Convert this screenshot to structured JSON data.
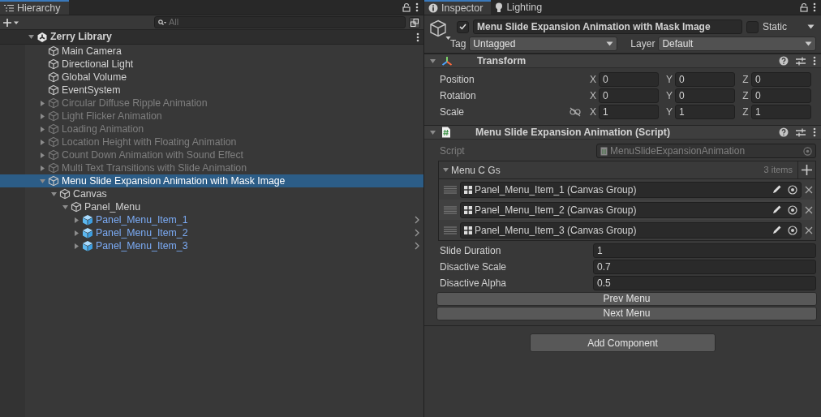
{
  "hierarchy": {
    "title": "Hierarchy",
    "search": {
      "placeholder": "All"
    },
    "tree": [
      {
        "kind": "scene",
        "label": "Zerry Library",
        "expanded": true,
        "selected": false,
        "disabled": false,
        "children": [
          {
            "kind": "object",
            "label": "Main Camera",
            "selected": false,
            "disabled": false
          },
          {
            "kind": "object",
            "label": "Directional Light",
            "selected": false,
            "disabled": false
          },
          {
            "kind": "object",
            "label": "Global Volume",
            "selected": false,
            "disabled": false
          },
          {
            "kind": "object",
            "label": "EventSystem",
            "selected": false,
            "disabled": false
          },
          {
            "kind": "object",
            "label": "Circular Diffuse Ripple Animation",
            "expanded": false,
            "selected": false,
            "disabled": true
          },
          {
            "kind": "object",
            "label": "Light Flicker Animation",
            "expanded": false,
            "selected": false,
            "disabled": true
          },
          {
            "kind": "object",
            "label": "Loading Animation",
            "expanded": false,
            "selected": false,
            "disabled": true
          },
          {
            "kind": "object",
            "label": "Location Height with Floating Animation",
            "expanded": false,
            "selected": false,
            "disabled": true
          },
          {
            "kind": "object",
            "label": "Count Down Animation with Sound Effect",
            "expanded": false,
            "selected": false,
            "disabled": true
          },
          {
            "kind": "object",
            "label": "Multi Text Transitions with Slide Animation",
            "expanded": false,
            "selected": false,
            "disabled": true
          },
          {
            "kind": "object",
            "label": "Menu Slide Expansion Animation with Mask Image",
            "expanded": true,
            "selected": true,
            "disabled": false,
            "children": [
              {
                "kind": "object",
                "label": "Canvas",
                "expanded": true,
                "selected": false,
                "disabled": false,
                "children": [
                  {
                    "kind": "object",
                    "label": "Panel_Menu",
                    "expanded": true,
                    "selected": false,
                    "disabled": false,
                    "children": [
                      {
                        "kind": "prefab",
                        "label": "Panel_Menu_Item_1",
                        "expanded": false,
                        "selected": false,
                        "disabled": false
                      },
                      {
                        "kind": "prefab",
                        "label": "Panel_Menu_Item_2",
                        "expanded": false,
                        "selected": false,
                        "disabled": false
                      },
                      {
                        "kind": "prefab",
                        "label": "Panel_Menu_Item_3",
                        "expanded": false,
                        "selected": false,
                        "disabled": false
                      }
                    ]
                  }
                ]
              }
            ]
          }
        ]
      }
    ]
  },
  "inspector": {
    "tabs": [
      {
        "label": "Inspector",
        "kind": "info",
        "selected": true
      },
      {
        "label": "Lighting",
        "kind": "bulb",
        "selected": false
      }
    ],
    "object": {
      "active": true,
      "name": "Menu Slide Expansion Animation with Mask Image",
      "static_label": "Static",
      "static": false,
      "tag_label": "Tag",
      "tag": "Untagged",
      "layer_label": "Layer",
      "layer": "Default"
    },
    "components": [
      {
        "kind": "transform",
        "title": "Transform",
        "expanded": true,
        "rows": [
          {
            "label": "Position",
            "axes": [
              "X",
              "Y",
              "Z"
            ],
            "values": [
              "0",
              "0",
              "0"
            ]
          },
          {
            "label": "Rotation",
            "axes": [
              "X",
              "Y",
              "Z"
            ],
            "values": [
              "0",
              "0",
              "0"
            ]
          },
          {
            "label": "Scale",
            "constrained": false,
            "axes": [
              "X",
              "Y",
              "Z"
            ],
            "values": [
              "1",
              "1",
              "1"
            ]
          }
        ]
      },
      {
        "kind": "script",
        "title": "Menu Slide Expansion Animation (Script)",
        "expanded": true,
        "script_label": "Script",
        "script": "MenuSlideExpansionAnimation",
        "list": {
          "label": "Menu C Gs",
          "expanded": true,
          "count": "3 items",
          "items": [
            "Panel_Menu_Item_1 (Canvas Group)",
            "Panel_Menu_Item_2 (Canvas Group)",
            "Panel_Menu_Item_3 (Canvas Group)"
          ]
        },
        "fields": [
          {
            "label": "Slide Duration",
            "value": "1"
          },
          {
            "label": "Disactive Scale",
            "value": "0.7"
          },
          {
            "label": "Disactive Alpha",
            "value": "0.5"
          }
        ],
        "buttons": [
          "Prev Menu",
          "Next Menu"
        ]
      }
    ],
    "add_component": "Add Component"
  }
}
